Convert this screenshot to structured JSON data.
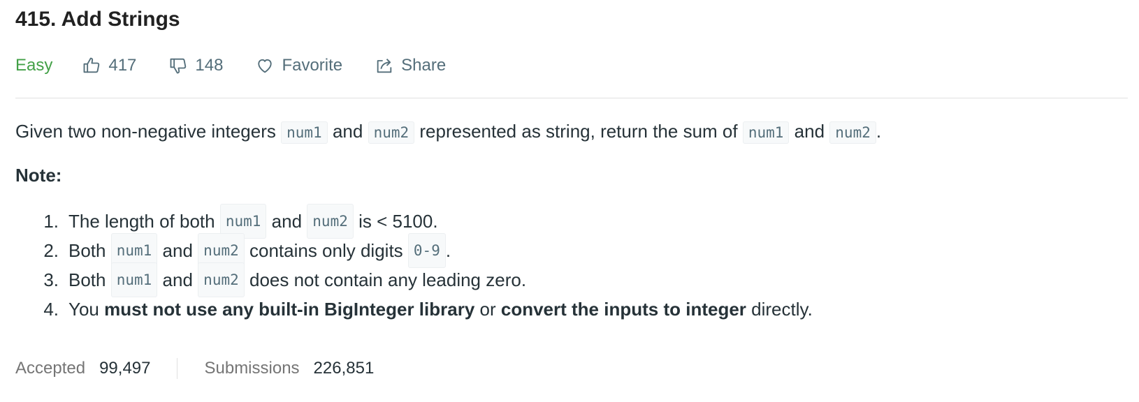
{
  "problem": {
    "title": "415. Add Strings",
    "difficulty": "Easy",
    "likes": "417",
    "dislikes": "148",
    "favorite_label": "Favorite",
    "share_label": "Share"
  },
  "description": {
    "given": "Given two non-negative integers",
    "num1": "num1",
    "num2": "num2",
    "and": "and",
    "represented": "represented as string, return the sum of",
    "period": "."
  },
  "note": {
    "title": "Note:",
    "items": [
      {
        "num": "1.",
        "pre": "The length of both",
        "code1": "num1",
        "and": "and",
        "code2": "num2",
        "post": "is < 5100."
      },
      {
        "num": "2.",
        "pre": "Both",
        "code1": "num1",
        "and": "and",
        "code2": "num2",
        "post": "contains only digits",
        "code3": "0-9",
        "end": "."
      },
      {
        "num": "3.",
        "pre": "Both",
        "code1": "num1",
        "and": "and",
        "code2": "num2",
        "post": "does not contain any leading zero."
      },
      {
        "num": "4.",
        "pre": "You",
        "bold1": "must not use any built-in BigInteger library",
        "mid": "or",
        "bold2": "convert the inputs to integer",
        "post": "directly."
      }
    ]
  },
  "stats": {
    "accepted_label": "Accepted",
    "accepted_value": "99,497",
    "submissions_label": "Submissions",
    "submissions_value": "226,851"
  },
  "colors": {
    "easy": "#43a047",
    "muted": "#546e7a",
    "text": "#263238"
  },
  "icons": {
    "like": "thumbs-up-icon",
    "dislike": "thumbs-down-icon",
    "favorite": "heart-icon",
    "share": "share-icon"
  }
}
